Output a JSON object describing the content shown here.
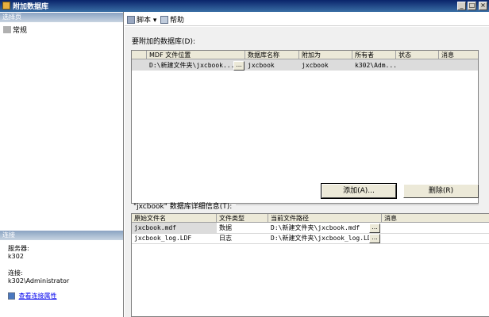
{
  "window": {
    "title": "附加数据库",
    "min": "_",
    "max": "□",
    "close": "×"
  },
  "left": {
    "select_page_header": "选择页",
    "nav_item": "常规",
    "connection_header": "连接",
    "server_label": "服务器:",
    "server_value": "k302",
    "connection_label": "连接:",
    "connection_value": "k302\\Administrator",
    "view_link": "查看连接属性"
  },
  "toolbar": {
    "script_label": "脚本",
    "script_arrow": "▾",
    "help_label": "帮助"
  },
  "attach_section": {
    "label": "要附加的数据库(D):",
    "columns": [
      "MDF 文件位置",
      "数据库名称",
      "附加为",
      "所有者",
      "状态",
      "消息"
    ],
    "rows": [
      {
        "mdf": "D:\\新建文件夹\\jxcbook...",
        "db": "jxcbook",
        "as": "jxcbook",
        "owner": "k302\\Adm...",
        "status": "",
        "msg": ""
      }
    ]
  },
  "buttons": {
    "add": "添加(A)...",
    "remove": "删除(R)"
  },
  "detail_section": {
    "label": "\"jxcbook\" 数据库详细信息(T):",
    "columns": [
      "原始文件名",
      "文件类型",
      "当前文件路径",
      "消息"
    ],
    "rows": [
      {
        "name": "jxcbook.mdf",
        "type": "数据",
        "path": "D:\\新建文件夹\\jxcbook.mdf",
        "msg": ""
      },
      {
        "name": "jxcbook_log.LDF",
        "type": "日志",
        "path": "D:\\新建文件夹\\jxcbook_log.LDF",
        "msg": ""
      }
    ]
  },
  "ellipsis": "..."
}
